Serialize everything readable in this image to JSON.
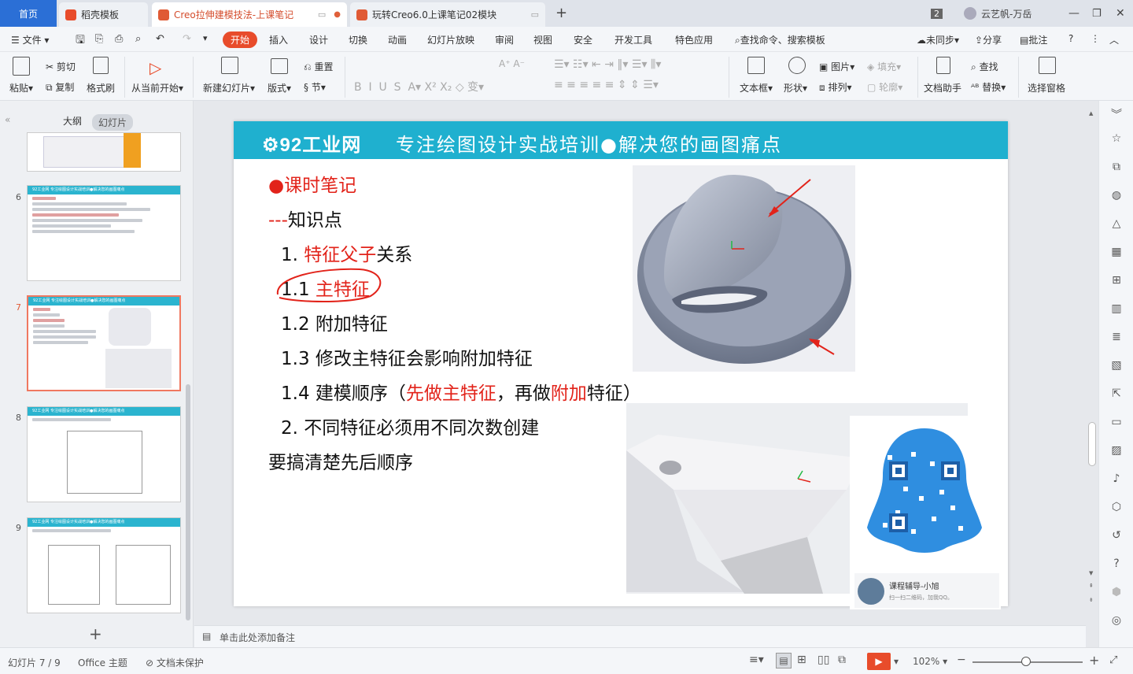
{
  "tabs": {
    "home": "首页",
    "tab1": "稻壳模板",
    "tab2": "Creo拉伸建模技法-上课笔记",
    "tab3": "玩转Creo6.0上课笔记02模块",
    "new_tab": "+"
  },
  "titlebar": {
    "badge": "2",
    "user": "云艺帆-万岳"
  },
  "menu": {
    "file": "文件",
    "items": [
      "开始",
      "插入",
      "设计",
      "切换",
      "动画",
      "幻灯片放映",
      "审阅",
      "视图",
      "安全",
      "开发工具",
      "特色应用"
    ],
    "search": "查找命令、搜索模板",
    "sync": "未同步",
    "share": "分享",
    "comment": "批注"
  },
  "ribbon": {
    "paste": "粘贴",
    "cut": "剪切",
    "copy": "复制",
    "format_painter": "格式刷",
    "from_current": "从当前开始",
    "new_slide": "新建幻灯片",
    "layout": "版式",
    "reset": "重置",
    "section": "节",
    "textbox": "文本框",
    "shape": "形状",
    "picture": "图片",
    "fill": "填充",
    "arrange": "排列",
    "outline": "轮廓",
    "find": "查找",
    "doc_helper": "文档助手",
    "replace": "替换",
    "select_pane": "选择窗格"
  },
  "panel": {
    "outline_tab": "大纲",
    "slides_tab": "幻灯片",
    "slide_numbers": [
      "6",
      "7",
      "8",
      "9"
    ],
    "thumb_header": "92工业网  专注绘图设计实战培训●解决您的画图痛点"
  },
  "slide": {
    "logo": "92工业网",
    "slogan": "专注绘图设计实战培训●解决您的画图痛点",
    "title": "●课时笔记",
    "subtitle": "---知识点",
    "line1_prefix": "1. ",
    "line1_red": "特征父子",
    "line1_suffix": "关系",
    "line2_prefix": "1.1 ",
    "line2_red": "主特征",
    "line3": "1.2 附加特征",
    "line4": "1.3 修改主特征会影响附加特征",
    "line5_a": "1.4 建模顺序（",
    "line5_red1": "先做主特征",
    "line5_b": "，再做",
    "line5_red2": "附加",
    "line5_c": "特征）",
    "line6": "2. 不同特征必须用不同次数创建",
    "line7": "要搞清楚先后顺序",
    "qr_name": "课程辅导-小旭",
    "qr_sub": "扫一扫二维码，加我QQ。"
  },
  "notes": {
    "placeholder": "单击此处添加备注"
  },
  "status": {
    "slide_pos": "幻灯片 7 / 9",
    "theme": "Office 主题",
    "protect": "文档未保护",
    "zoom": "102%"
  },
  "colors": {
    "accent": "#e84c2b",
    "header": "#1fb0cf",
    "red_text": "#e2231a",
    "home_tab": "#2b6fd6"
  }
}
